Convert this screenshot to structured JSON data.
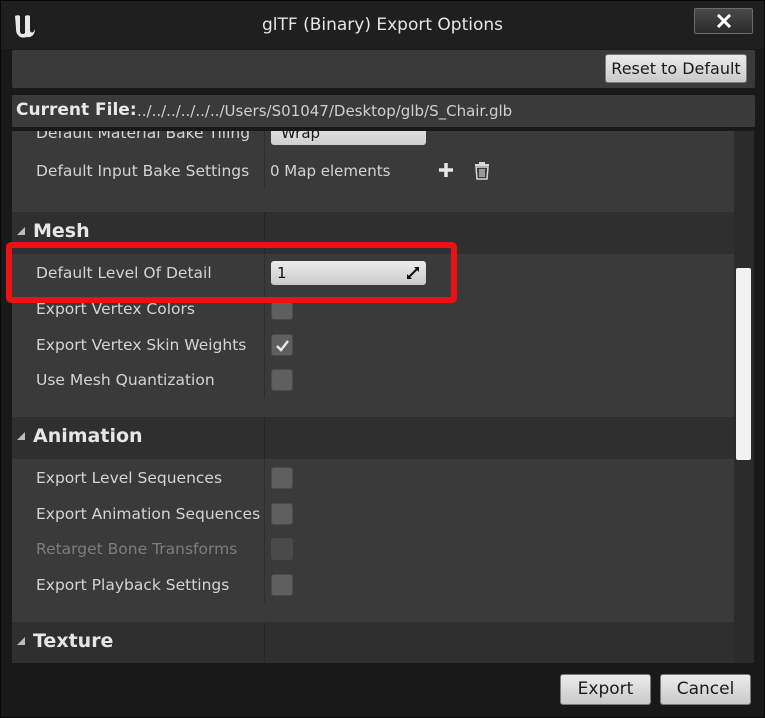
{
  "window": {
    "title": "glTF (Binary) Export Options",
    "close_icon": "close-icon"
  },
  "toolbar": {
    "reset_label": "Reset to Default"
  },
  "current_file": {
    "label": "Current File:",
    "path": "../../../../../../Users/S01047/Desktop/glb/S_Chair.glb"
  },
  "details": {
    "partial_row": {
      "label": "Default Material Bake Tiling",
      "value": "Wrap"
    },
    "input_bake": {
      "label": "Default Input Bake Settings",
      "value": "0 Map elements"
    },
    "sections": {
      "mesh": "Mesh",
      "animation": "Animation",
      "texture": "Texture"
    },
    "mesh_rows": {
      "lod": {
        "label": "Default Level Of Detail",
        "value": "1"
      },
      "vertex_colors": {
        "label": "Export Vertex Colors",
        "checked": false
      },
      "skin_weights": {
        "label": "Export Vertex Skin Weights",
        "checked": true
      },
      "quantization": {
        "label": "Use Mesh Quantization",
        "checked": false
      }
    },
    "animation_rows": {
      "level_sequences": {
        "label": "Export Level Sequences",
        "checked": false
      },
      "anim_sequences": {
        "label": "Export Animation Sequences",
        "checked": false
      },
      "retarget": {
        "label": "Retarget Bone Transforms",
        "checked": false,
        "disabled": true
      },
      "playback": {
        "label": "Export Playback Settings",
        "checked": false
      }
    }
  },
  "footer": {
    "export_label": "Export",
    "cancel_label": "Cancel"
  },
  "colors": {
    "highlight": "#ee1111",
    "panel": "#3a3a3a",
    "section": "#2f2f2f"
  }
}
